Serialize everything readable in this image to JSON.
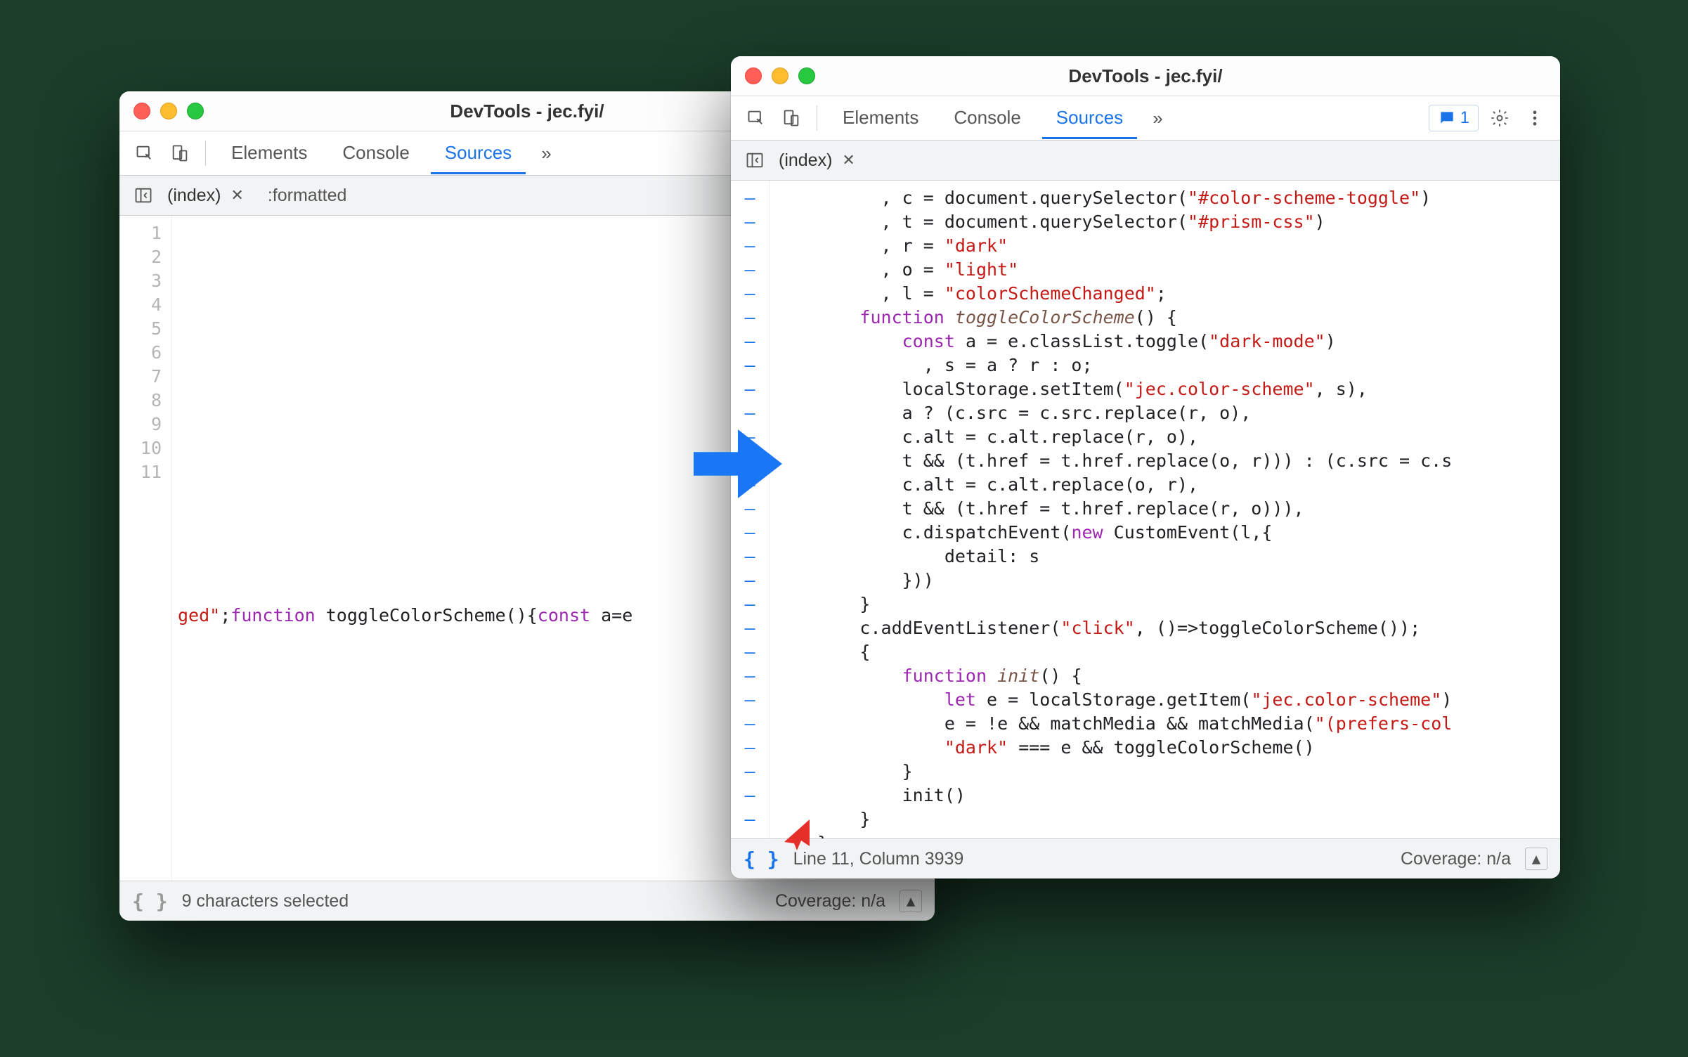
{
  "left": {
    "title": "DevTools - jec.fyi/",
    "tabs": {
      "elements": "Elements",
      "console": "Console",
      "sources": "Sources"
    },
    "file_tab": "(index)",
    "file_plain": ":formatted",
    "gutter": [
      "1",
      "2",
      "3",
      "4",
      "5",
      "6",
      "7",
      "8",
      "9",
      "10",
      "11"
    ],
    "code_line11_a": "ged\"",
    "code_line11_b": ";",
    "code_line11_kw1": "function",
    "code_line11_fn": " toggleColorScheme",
    "code_line11_c": "(){",
    "code_line11_kw2": "const",
    "code_line11_d": " a=e",
    "status_left": "9 characters selected",
    "status_right": "Coverage: n/a",
    "pretty_label": "{ }"
  },
  "right": {
    "title": "DevTools - jec.fyi/",
    "tabs": {
      "elements": "Elements",
      "console": "Console",
      "sources": "Sources"
    },
    "msg_count": "1",
    "file_tab": "(index)",
    "status_left": "Line 11, Column 3939",
    "status_right": "Coverage: n/a",
    "pretty_label": "{ }",
    "code": [
      [
        {
          "t": "punc",
          "v": "          , c = document.querySelector("
        },
        {
          "t": "str",
          "v": "\"#color-scheme-toggle\""
        },
        {
          "t": "punc",
          "v": ")"
        }
      ],
      [
        {
          "t": "punc",
          "v": "          , t = document.querySelector("
        },
        {
          "t": "str",
          "v": "\"#prism-css\""
        },
        {
          "t": "punc",
          "v": ")"
        }
      ],
      [
        {
          "t": "punc",
          "v": "          , r = "
        },
        {
          "t": "str",
          "v": "\"dark\""
        }
      ],
      [
        {
          "t": "punc",
          "v": "          , o = "
        },
        {
          "t": "str",
          "v": "\"light\""
        }
      ],
      [
        {
          "t": "punc",
          "v": "          , l = "
        },
        {
          "t": "str",
          "v": "\"colorSchemeChanged\""
        },
        {
          "t": "punc",
          "v": ";"
        }
      ],
      [
        {
          "t": "punc",
          "v": "        "
        },
        {
          "t": "kw",
          "v": "function"
        },
        {
          "t": "punc",
          "v": " "
        },
        {
          "t": "fn",
          "v": "toggleColorScheme"
        },
        {
          "t": "punc",
          "v": "() {"
        }
      ],
      [
        {
          "t": "punc",
          "v": "            "
        },
        {
          "t": "kw",
          "v": "const"
        },
        {
          "t": "punc",
          "v": " a = e.classList.toggle("
        },
        {
          "t": "str",
          "v": "\"dark-mode\""
        },
        {
          "t": "punc",
          "v": ")"
        }
      ],
      [
        {
          "t": "punc",
          "v": "              , s = a ? r : o;"
        }
      ],
      [
        {
          "t": "punc",
          "v": "            localStorage.setItem("
        },
        {
          "t": "str",
          "v": "\"jec.color-scheme\""
        },
        {
          "t": "punc",
          "v": ", s),"
        }
      ],
      [
        {
          "t": "punc",
          "v": "            a ? (c.src = c.src.replace(r, o),"
        }
      ],
      [
        {
          "t": "punc",
          "v": "            c.alt = c.alt.replace(r, o),"
        }
      ],
      [
        {
          "t": "punc",
          "v": "            t && (t.href = t.href.replace(o, r))) : (c.src = c.s"
        }
      ],
      [
        {
          "t": "punc",
          "v": "            c.alt = c.alt.replace(o, r),"
        }
      ],
      [
        {
          "t": "punc",
          "v": "            t && (t.href = t.href.replace(r, o))),"
        }
      ],
      [
        {
          "t": "punc",
          "v": "            c.dispatchEvent("
        },
        {
          "t": "kw",
          "v": "new"
        },
        {
          "t": "punc",
          "v": " CustomEvent(l,{"
        }
      ],
      [
        {
          "t": "punc",
          "v": "                detail: s"
        }
      ],
      [
        {
          "t": "punc",
          "v": "            }))"
        }
      ],
      [
        {
          "t": "punc",
          "v": "        }"
        }
      ],
      [
        {
          "t": "punc",
          "v": "        c.addEventListener("
        },
        {
          "t": "str",
          "v": "\"click\""
        },
        {
          "t": "punc",
          "v": ", ()=>toggleColorScheme());"
        }
      ],
      [
        {
          "t": "punc",
          "v": "        {"
        }
      ],
      [
        {
          "t": "punc",
          "v": "            "
        },
        {
          "t": "kw",
          "v": "function"
        },
        {
          "t": "punc",
          "v": " "
        },
        {
          "t": "fn",
          "v": "init"
        },
        {
          "t": "punc",
          "v": "() {"
        }
      ],
      [
        {
          "t": "punc",
          "v": "                "
        },
        {
          "t": "kw",
          "v": "let"
        },
        {
          "t": "punc",
          "v": " e = localStorage.getItem("
        },
        {
          "t": "str",
          "v": "\"jec.color-scheme\""
        },
        {
          "t": "punc",
          "v": ")"
        }
      ],
      [
        {
          "t": "punc",
          "v": "                e = !e && matchMedia && matchMedia("
        },
        {
          "t": "str",
          "v": "\"(prefers-col"
        }
      ],
      [
        {
          "t": "punc",
          "v": "                "
        },
        {
          "t": "str",
          "v": "\"dark\""
        },
        {
          "t": "punc",
          "v": " === e && toggleColorScheme()"
        }
      ],
      [
        {
          "t": "punc",
          "v": "            }"
        }
      ],
      [
        {
          "t": "punc",
          "v": "            init()"
        }
      ],
      [
        {
          "t": "punc",
          "v": "        }"
        }
      ],
      [
        {
          "t": "punc",
          "v": "    }"
        }
      ]
    ]
  }
}
